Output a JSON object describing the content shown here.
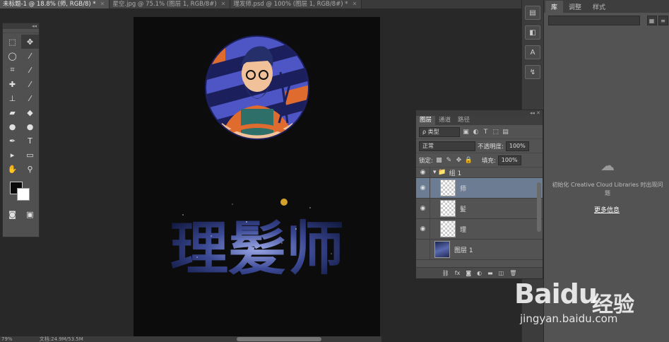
{
  "tabs": [
    {
      "label": "未标题-1 @ 18.8% (师, RGB/8) *",
      "active": true
    },
    {
      "label": "星空.jpg @ 75.1% (图层 1, RGB/8#)",
      "active": false
    },
    {
      "label": "理发师.psd @ 100% (图层 1, RGB/8#) *",
      "active": false
    }
  ],
  "toolbar": {
    "tools": [
      "rect-marquee",
      "move",
      "lasso",
      "magic-wand",
      "crop",
      "eyedropper",
      "healing",
      "brush",
      "stamp",
      "history-brush",
      "eraser",
      "paint-bucket",
      "blur",
      "dodge",
      "pen",
      "type",
      "path-select",
      "shape",
      "hand",
      "zoom"
    ],
    "swatch_fg": "#0a0a0a",
    "swatch_bg": "#ffffff"
  },
  "canvas": {
    "artwork_title": "理髪师"
  },
  "library": {
    "tabs": [
      "库",
      "调整",
      "样式"
    ],
    "cc_message": "初始化 Creative Cloud Libraries 时出现问题",
    "more_info": "更多信息"
  },
  "layers": {
    "tabs": [
      "图层",
      "通道",
      "路径"
    ],
    "filter_kind": "ρ 类型",
    "blend_mode": "正常",
    "opacity_label": "不透明度:",
    "opacity_value": "100%",
    "lock_label": "锁定:",
    "fill_label": "填充:",
    "fill_value": "100%",
    "items": [
      {
        "name": "组 1",
        "kind": "group",
        "visible": true,
        "selected": false
      },
      {
        "name": "师",
        "kind": "layer",
        "visible": true,
        "selected": true
      },
      {
        "name": "髪",
        "kind": "layer",
        "visible": true,
        "selected": false
      },
      {
        "name": "理",
        "kind": "layer",
        "visible": true,
        "selected": false
      },
      {
        "name": "图层 1",
        "kind": "photo",
        "visible": false,
        "selected": false
      }
    ]
  },
  "status": {
    "zoom": "79%",
    "doc": "文档:24.9M/53.5M"
  },
  "watermark": {
    "logo": "Baidu",
    "cn": "经验",
    "url": "jingyan.baidu.com"
  }
}
